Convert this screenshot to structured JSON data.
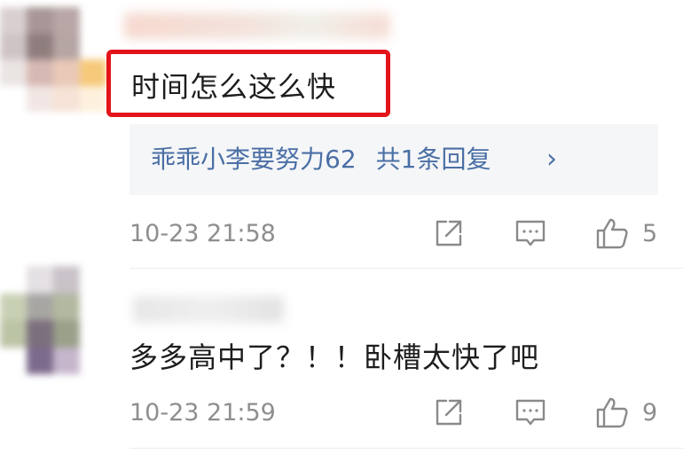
{
  "comments": [
    {
      "text": "时间怎么这么快",
      "reply_summary": {
        "user": "乖乖小李要努力62",
        "count_label": "共1条回复",
        "chevron": "›"
      },
      "timestamp": "10-23 21:58",
      "likes": "5",
      "highlight_color": "#e3141a"
    },
    {
      "text": "多多高中了？！！卧槽太快了吧",
      "timestamp": "10-23 21:59",
      "likes": "9"
    }
  ],
  "colors": {
    "link": "#4a6fa5",
    "meta_text": "#8e8e8e",
    "reply_bg": "#f5f6f8"
  },
  "icons": {
    "share": "share-edit-icon",
    "reply": "comment-bubble-icon",
    "like": "thumbs-up-icon"
  }
}
